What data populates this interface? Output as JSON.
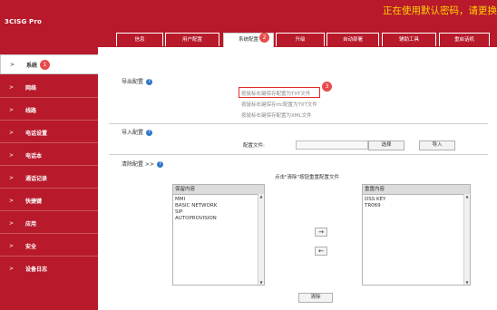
{
  "header": {
    "logo": "3CISG Pro",
    "warning": "正在使用默认密码，请更换"
  },
  "tabs": [
    {
      "label": "信息"
    },
    {
      "label": "用户配置"
    },
    {
      "label": "系统配置"
    },
    {
      "label": "升级"
    },
    {
      "label": "自动部署"
    },
    {
      "label": "辅助工具"
    },
    {
      "label": "重启话机"
    }
  ],
  "sidebar": {
    "items": [
      {
        "label": "系统",
        "badge": "1"
      },
      {
        "label": "网络"
      },
      {
        "label": "线路"
      },
      {
        "label": "电话设置"
      },
      {
        "label": "电话本"
      },
      {
        "label": "通话记录"
      },
      {
        "label": "快捷键"
      },
      {
        "label": "应用"
      },
      {
        "label": "安全"
      },
      {
        "label": "设备日志"
      }
    ]
  },
  "badges": {
    "tab": "2",
    "export": "3"
  },
  "export": {
    "title": "导出配置",
    "links": [
      "按鼠标右键保存配置为TXT文件",
      "按鼠标右键保存rtc配置为TXT文件",
      "按鼠标右键保存配置为XML文件"
    ]
  },
  "import": {
    "title": "导入配置",
    "file_label": "配置文件:",
    "browse": "选择",
    "import_btn": "导入"
  },
  "clear": {
    "title": "清除配置 >>",
    "instruction": "点击\"清除\"按钮重置配置文件",
    "keep_header": "保留内容",
    "keep_items": [
      "MMI",
      "BASIC NETWORK",
      "SIP",
      "AUTOPROVISION"
    ],
    "reset_header": "重置内容",
    "reset_items": [
      "DSS KEY",
      "TR069"
    ],
    "move_right": "→",
    "move_left": "←",
    "clear_btn": "清除"
  }
}
